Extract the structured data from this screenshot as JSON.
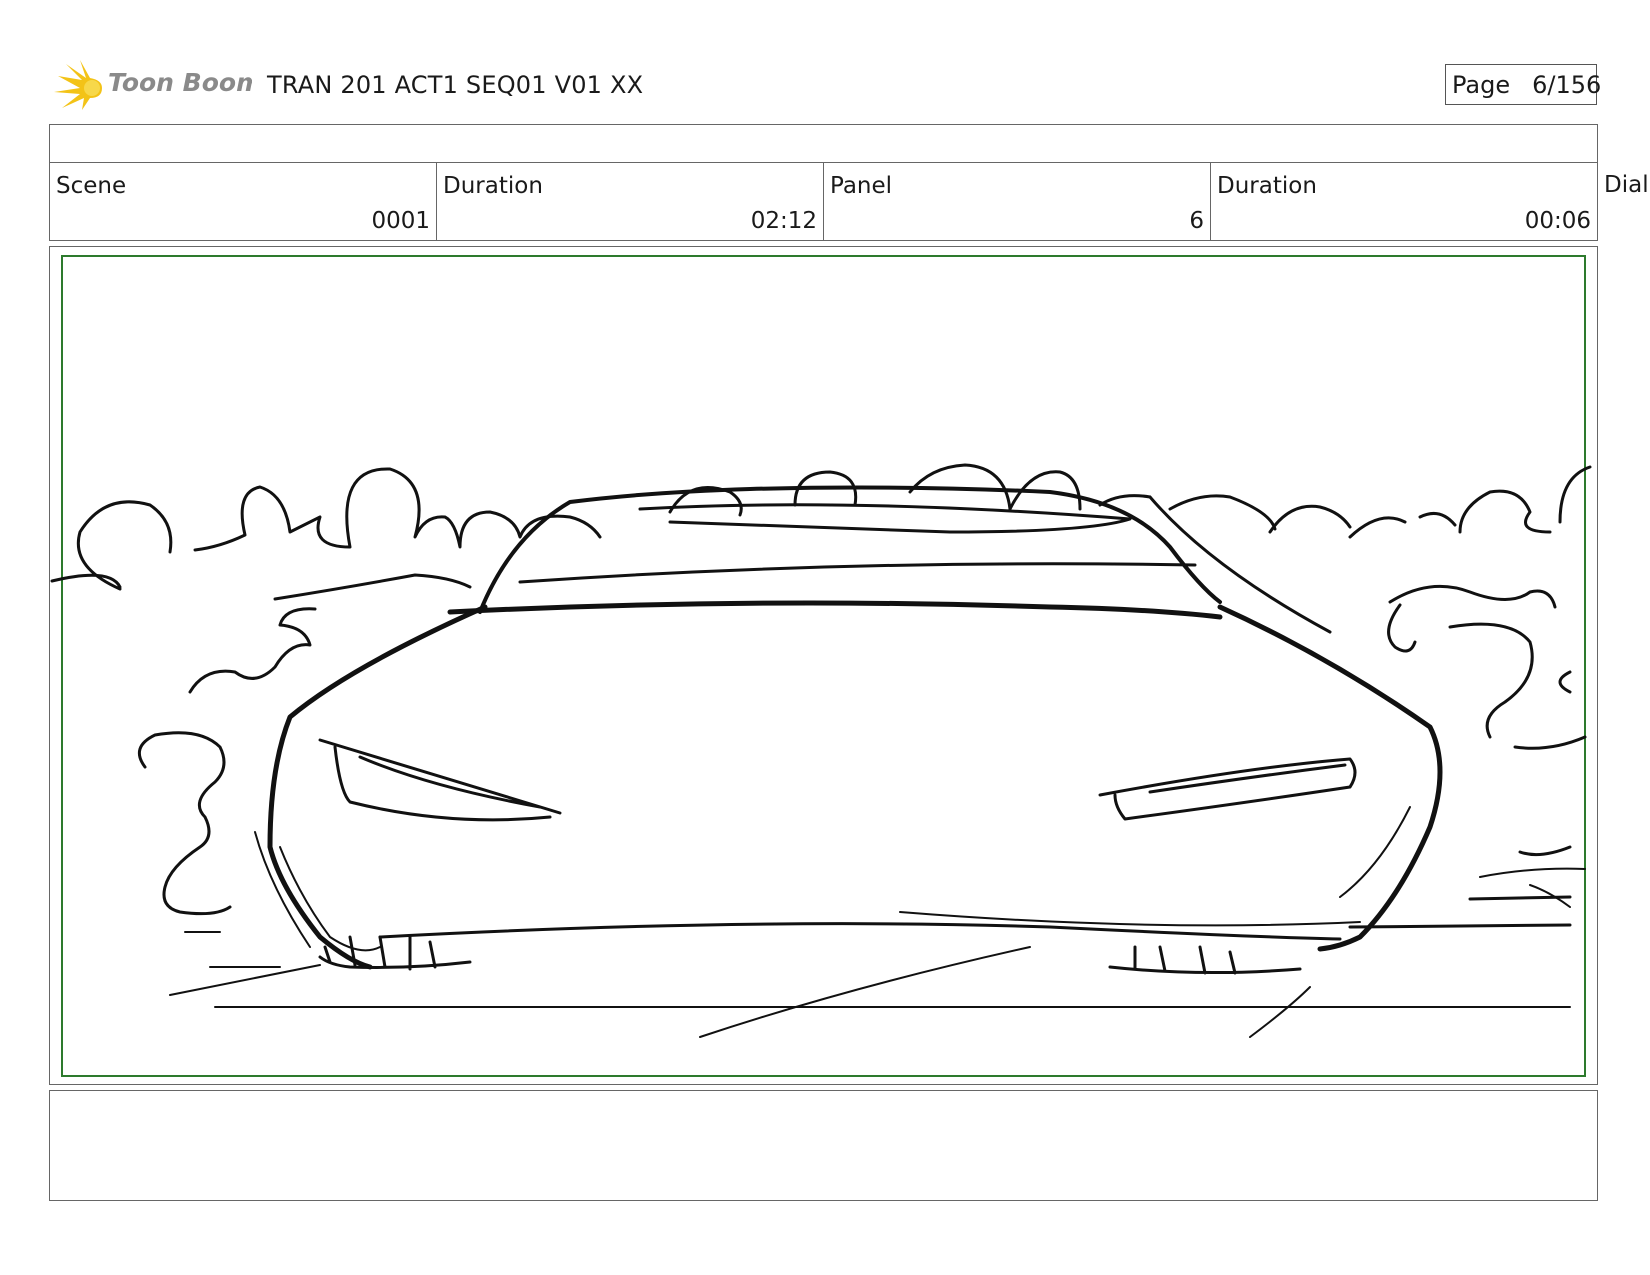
{
  "header": {
    "logo_text": "Toon Boom",
    "doc_title": "TRAN 201 ACT1 SEQ01 V01 XX",
    "page_label": "Page",
    "page_number": "6/156"
  },
  "info": {
    "scene_label": "Scene",
    "scene_value": "0001",
    "scene_duration_label": "Duration",
    "scene_duration_value": "02:12",
    "panel_label": "Panel",
    "panel_value": "6",
    "panel_duration_label": "Duration",
    "panel_duration_value": "00:06",
    "dialogue_label_partial": "Dial"
  },
  "colors": {
    "logo_sun": "#f3c317",
    "logo_text": "#8a8a8a",
    "safe_frame": "#2d7a2d",
    "sketch": "#111111"
  },
  "panel": {
    "image": "car-front-sketch"
  }
}
